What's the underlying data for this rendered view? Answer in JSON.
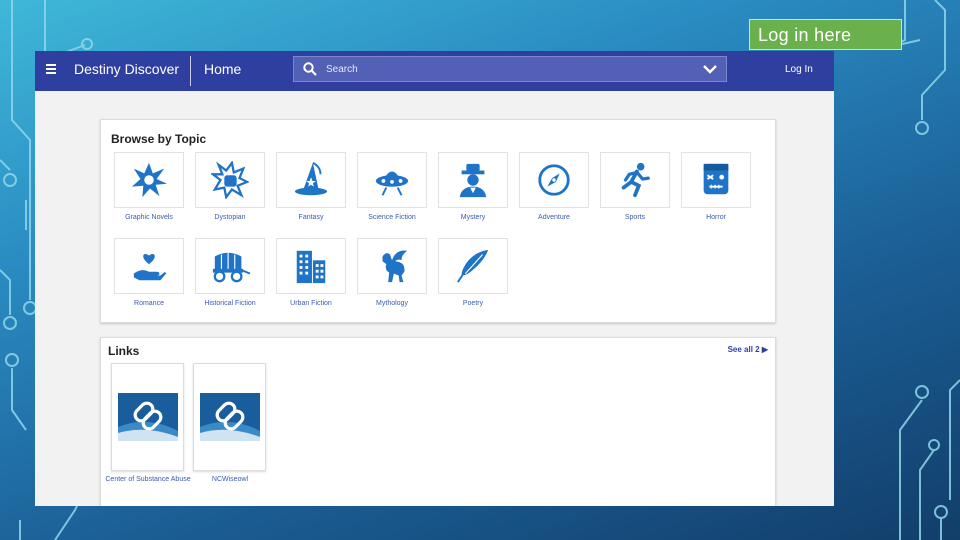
{
  "callout": {
    "text": "Log in here",
    "color": "#6ab04c"
  },
  "topbar": {
    "menu_icon": "hamburger-icon",
    "brand": "Destiny Discover",
    "home": "Home",
    "search_placeholder": "Search",
    "login": "Log In",
    "color": "#2f3f9f"
  },
  "browse": {
    "title": "Browse by Topic",
    "topics": [
      {
        "label": "Graphic Novels",
        "icon": "comic-burst-icon"
      },
      {
        "label": "Dystopian",
        "icon": "fist-icon"
      },
      {
        "label": "Fantasy",
        "icon": "wizard-hat-icon"
      },
      {
        "label": "Science Fiction",
        "icon": "ufo-icon"
      },
      {
        "label": "Mystery",
        "icon": "detective-icon"
      },
      {
        "label": "Adventure",
        "icon": "compass-icon"
      },
      {
        "label": "Sports",
        "icon": "runner-icon"
      },
      {
        "label": "Horror",
        "icon": "monster-icon"
      },
      {
        "label": "Romance",
        "icon": "heart-hand-icon"
      },
      {
        "label": "Historical Fiction",
        "icon": "wagon-icon"
      },
      {
        "label": "Urban Fiction",
        "icon": "buildings-icon"
      },
      {
        "label": "Mythology",
        "icon": "pegasus-icon"
      },
      {
        "label": "Poetry",
        "icon": "quill-icon"
      }
    ]
  },
  "links": {
    "title": "Links",
    "see_all": "See all 2",
    "items": [
      {
        "label": "Center of Substance Abuse",
        "icon": "link-icon"
      },
      {
        "label": "NCWiseowl",
        "icon": "link-icon"
      }
    ]
  }
}
